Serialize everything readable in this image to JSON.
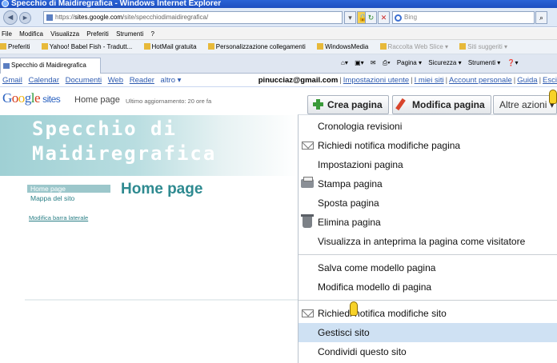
{
  "window": {
    "title": "Specchio di Maidiregrafica - Windows Internet Explorer"
  },
  "address": {
    "prefix": "https://",
    "domain": "sites.google.com",
    "path": "/site/specchiodimaidiregrafica/"
  },
  "search": {
    "placeholder": "Bing"
  },
  "menubar": [
    "File",
    "Modifica",
    "Visualizza",
    "Preferiti",
    "Strumenti",
    "?"
  ],
  "favorites": {
    "label": "Preferiti",
    "items": [
      {
        "label": "Yahoo! Babel Fish - Tradutt...",
        "dim": false
      },
      {
        "label": "HotMail gratuita",
        "dim": false
      },
      {
        "label": "Personalizzazione collegamenti",
        "dim": false
      },
      {
        "label": "WindowsMedia",
        "dim": false
      },
      {
        "label": "Raccolta Web Slice ▾",
        "dim": true
      },
      {
        "label": "Siti suggeriti ▾",
        "dim": true
      }
    ]
  },
  "tab": {
    "label": "Specchio di Maidiregrafica"
  },
  "commandbar": [
    "Pagina ▾",
    "Sicurezza ▾",
    "Strumenti ▾"
  ],
  "googlebar": {
    "links": [
      "Gmail",
      "Calendar",
      "Documenti",
      "Web",
      "Reader",
      "altro ▾"
    ],
    "email": "pinucciaz@gmail.com",
    "right_links": [
      "Impostazioni utente",
      "I miei siti",
      "Account personale",
      "Guida",
      "Esci"
    ]
  },
  "site_header": {
    "logo_text": "Google",
    "logo_sites": "sites",
    "page_name": "Home page",
    "updated": "Ultimo aggiornamento: 20 ore fa",
    "create_label": "Crea pagina",
    "edit_label": "Modifica pagina",
    "more_label": "Altre azioni ▾"
  },
  "banner": {
    "line1": "Specchio di",
    "line2": "Maidiregrafica"
  },
  "sidebar": {
    "items": [
      "Home page",
      "Mappa del sito"
    ],
    "edit_link": "Modifica barra laterale"
  },
  "page_title": "Home page",
  "more_menu": {
    "items": [
      {
        "label": "Cronologia revisioni",
        "icon": "none"
      },
      {
        "label": "Richiedi notifica modifiche pagina",
        "icon": "envelope-icon"
      },
      {
        "label": "Impostazioni pagina",
        "icon": "none"
      },
      {
        "label": "Stampa pagina",
        "icon": "printer-icon"
      },
      {
        "label": "Sposta pagina",
        "icon": "none"
      },
      {
        "label": "Elimina pagina",
        "icon": "trash-icon"
      },
      {
        "label": "Visualizza in anteprima la pagina come visitatore",
        "icon": "none"
      },
      {
        "label": "Salva come modello pagina",
        "icon": "none"
      },
      {
        "label": "Modifica modello di pagina",
        "icon": "none"
      },
      {
        "label": "Richiedi notifica modifiche sito",
        "icon": "envelope-icon"
      },
      {
        "label": "Gestisci sito",
        "icon": "none",
        "highlighted": true
      },
      {
        "label": "Condividi questo sito",
        "icon": "none"
      }
    ]
  }
}
